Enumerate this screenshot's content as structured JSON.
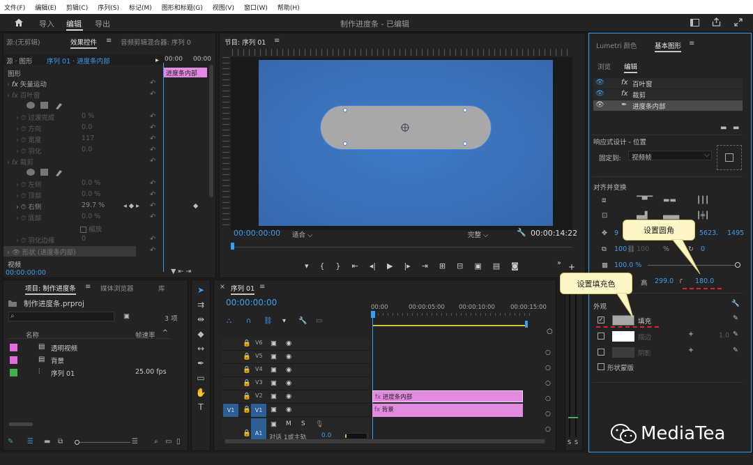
{
  "menu": [
    "文件(F)",
    "编辑(E)",
    "剪辑(C)",
    "序列(S)",
    "标记(M)",
    "图形和标题(G)",
    "视图(V)",
    "窗口(W)",
    "帮助(H)"
  ],
  "header": {
    "tabs": [
      "导入",
      "编辑",
      "导出"
    ],
    "title": "制作进度条 - 已编辑"
  },
  "effects_panel": {
    "tabs": [
      "源:(无剪辑)",
      "效果控件",
      "音频剪辑混合器: 序列 0"
    ],
    "source_label": "源 · 图形",
    "clip_label": "序列 01 · 进度条内部",
    "time_start": "00:00",
    "time_end": "00:00",
    "clip_bar": "进度条内部",
    "section": "图形",
    "items": [
      {
        "label": "矢量运动",
        "value": "",
        "type": "fx"
      },
      {
        "label": "百叶窗",
        "value": "",
        "type": "fx"
      },
      {
        "label": "过渡完成",
        "value": "0 %",
        "type": "prop"
      },
      {
        "label": "方向",
        "value": "0.0",
        "type": "prop"
      },
      {
        "label": "宽度",
        "value": "117",
        "type": "prop"
      },
      {
        "label": "羽化",
        "value": "0.0",
        "type": "prop"
      },
      {
        "label": "裁剪",
        "value": "",
        "type": "fx"
      },
      {
        "label": "左侧",
        "value": "0.0 %",
        "type": "prop"
      },
      {
        "label": "顶部",
        "value": "0.0 %",
        "type": "prop"
      },
      {
        "label": "右侧",
        "value": "29.7 %",
        "type": "prop"
      },
      {
        "label": "底部",
        "value": "0.0 %",
        "type": "prop"
      },
      {
        "label": "缩放",
        "value": "",
        "type": "check"
      },
      {
        "label": "羽化边缘",
        "value": "0",
        "type": "prop"
      },
      {
        "label": "形状 (进度条内部)",
        "value": "",
        "type": "fx"
      }
    ],
    "footer_label": "视频",
    "timecode": "00:00:00:00"
  },
  "program_monitor": {
    "title": "节目: 序列 01",
    "timecode_left": "00:00:00:00",
    "fit": "适合",
    "quality": "完整",
    "timecode_right": "00:00:14:22"
  },
  "project_panel": {
    "tabs": [
      "项目: 制作进度条",
      "媒体浏览器",
      "库"
    ],
    "file": "制作进度条.prproj",
    "count": "3 项",
    "col_name": "名称",
    "col_fps": "帧速率",
    "items": [
      {
        "name": "透明视频",
        "fps": "",
        "color": "#e36ce0"
      },
      {
        "name": "背景",
        "fps": "",
        "color": "#e36ce0"
      },
      {
        "name": "序列 01",
        "fps": "25.00 fps",
        "color": "#3db34a"
      }
    ]
  },
  "timeline": {
    "title": "序列 01",
    "timecode": "00:00:00:00",
    "ruler": [
      "00:00",
      "00:00:05:00",
      "00:00:10:00",
      "00:00:15:00"
    ],
    "tracks": [
      "V6",
      "V5",
      "V4",
      "V3",
      "V2",
      "V1"
    ],
    "src_label": "V1",
    "audio_track": "A1",
    "audio_label": "对话 1或主轨",
    "audio_value": "0.0",
    "clips": [
      {
        "label": "进度条内部",
        "track": "V2"
      },
      {
        "label": "背景",
        "track": "V1"
      }
    ]
  },
  "essential_graphics": {
    "tabs": [
      "Lumetri 颜色",
      "基本图形"
    ],
    "subtabs": [
      "浏览",
      "编辑"
    ],
    "layers": [
      "百叶窗",
      "裁剪",
      "进度条内部"
    ],
    "responsive_title": "响应式设计 - 位置",
    "pin_label": "固定到:",
    "pin_value": "视频帧",
    "align_title": "对齐并变换",
    "pos_x": "5623.",
    "pos_y": "1495",
    "pos_left": "9",
    "scale": "100",
    "scale2": "100",
    "rotation": "0",
    "opacity": "100.0 %",
    "height_label": "高",
    "height": "299.0",
    "corner_radius": "180.0",
    "appearance_title": "外观",
    "fill_label": "填充",
    "stroke_label": "描边",
    "stroke_value": "1.0",
    "shadow_label": "阴影",
    "mask_label": "形状蒙版"
  },
  "callouts": {
    "corner": "设置圆角",
    "fill": "设置填充色"
  },
  "watermark": "MediaTea",
  "colors": {
    "accent": "#3a9ef0",
    "clip": "#e08ae0",
    "canvas": "#3b75c0",
    "shape": "#a8a8a8",
    "callout": "#fdf6c6",
    "marker": "#e0202a"
  }
}
